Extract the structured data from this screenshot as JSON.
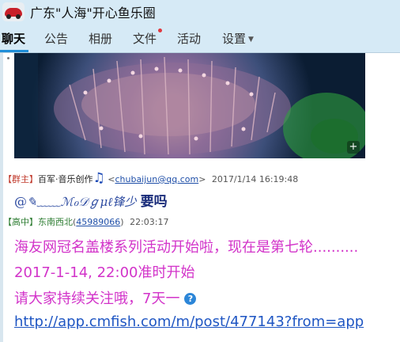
{
  "window": {
    "title": "广东\"人海\"开心鱼乐圈",
    "avatar_icon": "car-avatar-icon"
  },
  "tabs": [
    {
      "label": "聊天",
      "active": true
    },
    {
      "label": "公告",
      "active": false
    },
    {
      "label": "相册",
      "active": false
    },
    {
      "label": "文件",
      "active": false,
      "has_notification_dot": true
    },
    {
      "label": "活动",
      "active": false
    },
    {
      "label": "设置",
      "active": false,
      "dropdown": true
    }
  ],
  "chat": {
    "photo_message": {
      "expand_icon": "plus-icon"
    },
    "msg1": {
      "role": "【群主】",
      "sender": "百军·音乐创作",
      "music_icon": "music-note-icon",
      "email_open": "<",
      "email": "chubaijun@qq.com",
      "email_close": ">",
      "time": "2017/1/14 16:19:48",
      "mention_prefix": "@",
      "mention_nick": "✎﹏﹏ℳℴ𝒟ℊμℓ锋少",
      "text": "要吗"
    },
    "msg2": {
      "role": "【高中】",
      "sender": "东南西北",
      "qq_open": "(",
      "qq": "45989066",
      "qq_close": ")",
      "time": "22:03:17",
      "lines": [
        "海友网冠名盖楼系列活动开始啦，现在是第七轮..........",
        "2017-1-14, 22:00准时开始",
        "请大家持续关注哦，7天一"
      ],
      "help_icon": "question-icon",
      "link": "http://app.cmfish.com/m/post/477143?from=app"
    }
  }
}
